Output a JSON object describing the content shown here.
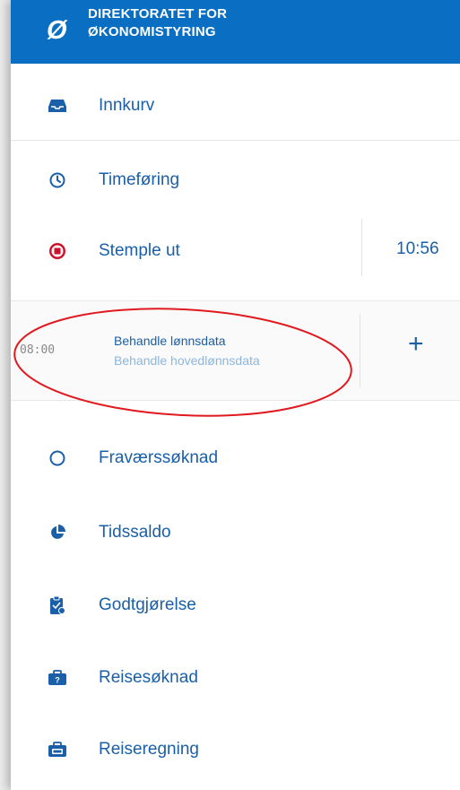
{
  "header": {
    "logo_glyph": "Ø",
    "org_line1": "DIREKTORATET FOR",
    "org_line2": "ØKONOMISTYRING",
    "color": "#0a6fc2"
  },
  "menu": {
    "inbox": {
      "label": "Innkurv",
      "icon": "inbox-icon"
    },
    "timesheet": {
      "label": "Timeføring",
      "icon": "clock-icon"
    },
    "stamp_out": {
      "label": "Stemple ut",
      "icon": "stop-record-icon",
      "time": "10:56"
    },
    "absence": {
      "label": "Fraværssøknad",
      "icon": "circle-outline-icon"
    },
    "time_balance": {
      "label": "Tidssaldo",
      "icon": "pie-chart-icon"
    },
    "compensation": {
      "label": "Godtgjørelse",
      "icon": "clipboard-icon"
    },
    "travel_application": {
      "label": "Reisesøknad",
      "icon": "briefcase-question-icon"
    },
    "travel_expense": {
      "label": "Reiseregning",
      "icon": "briefcase-kr-icon"
    }
  },
  "entry": {
    "time": "08:00",
    "title": "Behandle lønnsdata",
    "subtitle": "Behandle hovedlønnsdata",
    "add_symbol": "+"
  },
  "colors": {
    "accent": "#1a5fa8",
    "stop_red": "#d0112b",
    "annotation_red": "#e0191f"
  }
}
